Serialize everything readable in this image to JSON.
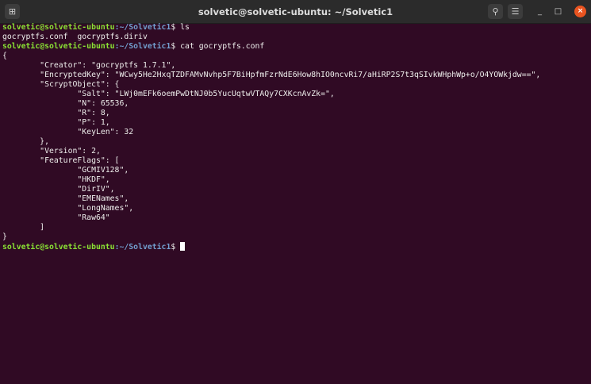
{
  "window": {
    "title": "solvetic@solvetic-ubuntu: ~/Solvetic1",
    "new_tab_icon": "new-tab-icon",
    "search_icon": "search-icon",
    "menu_icon": "hamburger-menu-icon",
    "minimize": "_",
    "maximize": "□",
    "close": "×"
  },
  "prompt": {
    "user_host": "solvetic@solvetic-ubuntu",
    "path": ":~/Solvetic1",
    "symbol": "$"
  },
  "lines": [
    {
      "type": "prompt",
      "cmd": " ls"
    },
    {
      "type": "out",
      "text": "gocryptfs.conf  gocryptfs.diriv"
    },
    {
      "type": "prompt",
      "cmd": " cat gocryptfs.conf"
    },
    {
      "type": "out",
      "text": "{"
    },
    {
      "type": "out",
      "text": "        \"Creator\": \"gocryptfs 1.7.1\","
    },
    {
      "type": "out",
      "text": "        \"EncryptedKey\": \"WCwy5He2HxqTZDFAMvNvhp5F7BiHpfmFzrNdE6How8hIO0ncvRi7/aHiRP2S7t3qSIvkWHphWp+o/O4YOWkjdw==\","
    },
    {
      "type": "out",
      "text": "        \"ScryptObject\": {"
    },
    {
      "type": "out",
      "text": "                \"Salt\": \"LWj0mEFk6oemPwDtNJ0b5YucUqtwVTAQy7CXKcnAvZk=\","
    },
    {
      "type": "out",
      "text": "                \"N\": 65536,"
    },
    {
      "type": "out",
      "text": "                \"R\": 8,"
    },
    {
      "type": "out",
      "text": "                \"P\": 1,"
    },
    {
      "type": "out",
      "text": "                \"KeyLen\": 32"
    },
    {
      "type": "out",
      "text": "        },"
    },
    {
      "type": "out",
      "text": "        \"Version\": 2,"
    },
    {
      "type": "out",
      "text": "        \"FeatureFlags\": ["
    },
    {
      "type": "out",
      "text": "                \"GCMIV128\","
    },
    {
      "type": "out",
      "text": "                \"HKDF\","
    },
    {
      "type": "out",
      "text": "                \"DirIV\","
    },
    {
      "type": "out",
      "text": "                \"EMENames\","
    },
    {
      "type": "out",
      "text": "                \"LongNames\","
    },
    {
      "type": "out",
      "text": "                \"Raw64\""
    },
    {
      "type": "out",
      "text": "        ]"
    },
    {
      "type": "out",
      "text": "}"
    },
    {
      "type": "prompt",
      "cmd": " "
    }
  ]
}
